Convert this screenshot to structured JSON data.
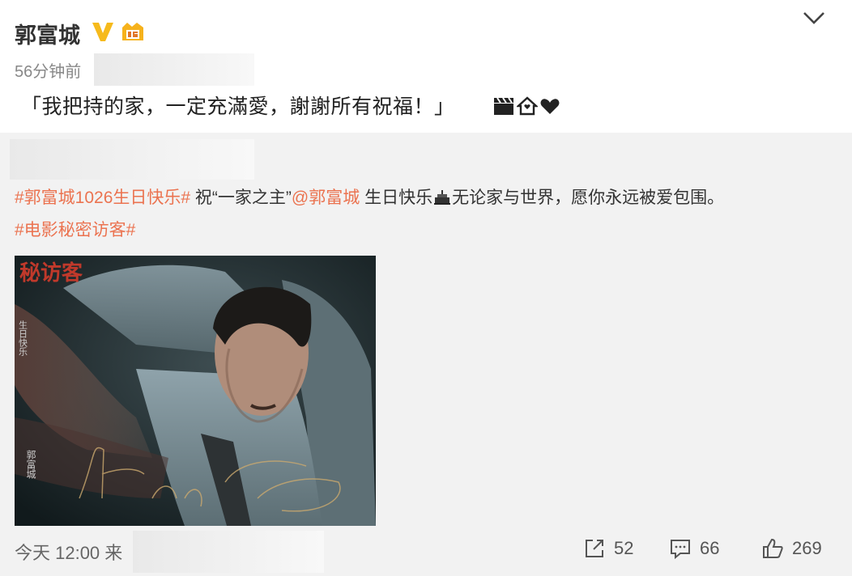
{
  "post": {
    "user_name": "郭富城",
    "verified_icon": "verified-v-icon",
    "level_icon": "level-badge-icon",
    "time": "56分钟前",
    "text": "「我把持的家，一定充滿愛，謝謝所有祝福！」",
    "emoji": [
      "clapperboard-icon",
      "house-icon",
      "heart-icon"
    ]
  },
  "repost": {
    "topic_birthday": "#郭富城1026生日快乐#",
    "text_part1": " 祝“一家之主”",
    "mention": "@郭富城",
    "text_part2": " 生日快乐",
    "text_part3": "无论家与世界，愿你永远被爱包围。",
    "topic_movie": "#电影秘密访客#",
    "time": "今天 12:00 来",
    "repost_count": "52",
    "comment_count": "66",
    "like_count": "269"
  },
  "colors": {
    "topic": "#eb7350",
    "verified": "#f6ba1c",
    "repost_bg": "#f2f2f2"
  }
}
